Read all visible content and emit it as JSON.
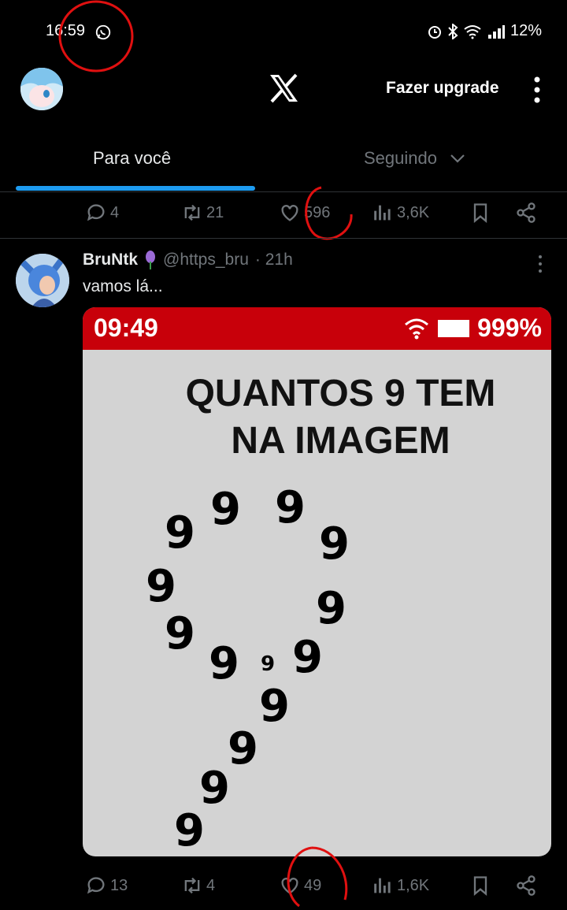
{
  "status_bar": {
    "time": "16:59",
    "battery": "12%",
    "icons": [
      "whatsapp-icon",
      "alarm-icon",
      "bluetooth-icon",
      "wifi-icon",
      "signal-icon"
    ]
  },
  "header": {
    "logo": "x-logo-icon",
    "upgrade_label": "Fazer upgrade"
  },
  "tabs": [
    {
      "label": "Para você",
      "active": true
    },
    {
      "label": "Seguindo",
      "active": false
    }
  ],
  "previous_tweet_actions": {
    "replies": "4",
    "retweets": "21",
    "likes": "596",
    "views": "3,6K"
  },
  "tweet": {
    "name": "BruNtk",
    "handle": "@https_bru",
    "time": "· 21h",
    "text": "vamos lá...",
    "media": {
      "phone_time": "09:49",
      "phone_battery": "999%",
      "title_line1": "QUANTOS 9 TEM",
      "title_line2": "NA IMAGEM",
      "digit": "9",
      "small_digit": "9"
    },
    "actions": {
      "replies": "13",
      "retweets": "4",
      "likes": "49",
      "views": "1,6K"
    }
  },
  "colors": {
    "accent": "#1d9bf0",
    "background": "#000000",
    "muted": "#71767b",
    "annotation": "#e01010",
    "phone_bar": "#c8000a"
  }
}
